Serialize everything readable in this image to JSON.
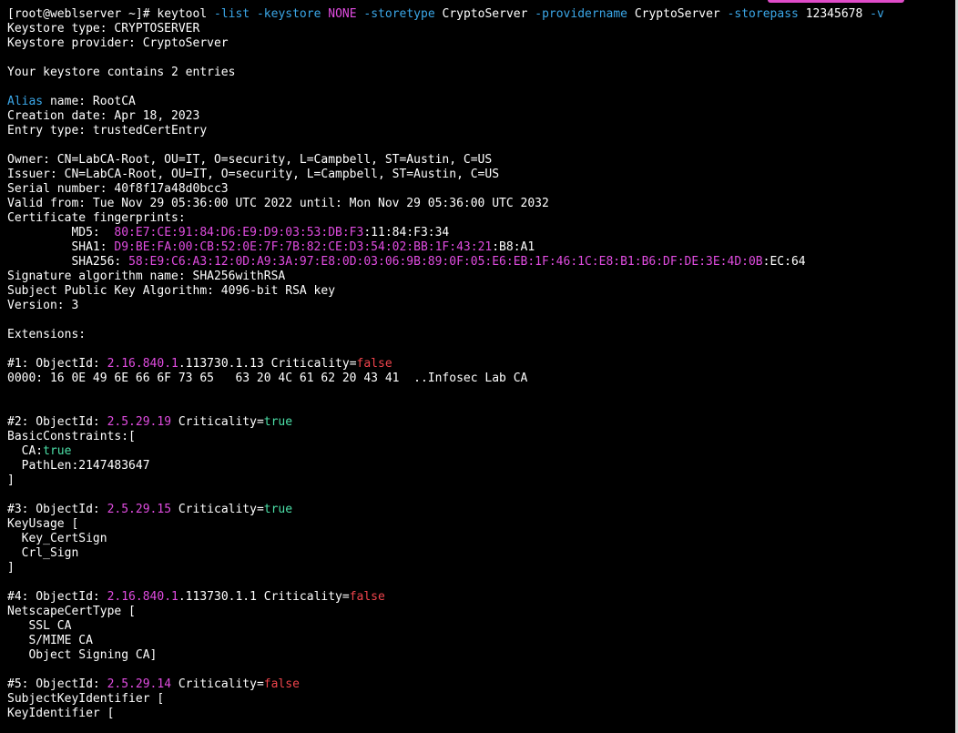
{
  "prompt": {
    "text": "[root@weblserver ~]# ",
    "cmd": "keytool",
    "opt_list": "-list",
    "opt_keystore": "-keystore",
    "keystore_value": "NONE",
    "opt_storetype": "-storetype",
    "storetype_value": "CryptoServer",
    "opt_providername": "-providername",
    "providername_value": "CryptoServer",
    "opt_storepass": "-storepass",
    "storepass_value": "12345678",
    "opt_v": "-v"
  },
  "keystore": {
    "type_line": "Keystore type: CRYPTOSERVER",
    "provider_line": "Keystore provider: CryptoServer",
    "entries_line": "Your keystore contains 2 entries"
  },
  "entry": {
    "alias_label": "Alias",
    "alias_rest": " name: RootCA",
    "creation": "Creation date: Apr 18, 2023",
    "entry_type": "Entry type: trustedCertEntry",
    "owner": "Owner: CN=LabCA-Root, OU=IT, O=security, L=Campbell, ST=Austin, C=US",
    "issuer": "Issuer: CN=LabCA-Root, OU=IT, O=security, L=Campbell, ST=Austin, C=US",
    "serial": "Serial number: 40f8f17a48d0bcc3",
    "valid": "Valid from: Tue Nov 29 05:36:00 UTC 2022 until: Mon Nov 29 05:36:00 UTC 2032",
    "fp_header": "Certificate fingerprints:",
    "md5_label": "         MD5:  ",
    "md5_hl": "80:E7:CE:91:84:D6:E9:D9:03:53:DB:F3",
    "md5_rest": ":11:84:F3:34",
    "sha1_label": "         SHA1: ",
    "sha1_hl": "D9:BE:FA:00:CB:52:0E:7F:7B:82:CE:D3:54:02:BB:1F:43:21",
    "sha1_rest": ":B8:A1",
    "sha256_label": "         SHA256: ",
    "sha256_hl": "58:E9:C6:A3:12:0D:A9:3A:97:E8:0D:03:06:9B:89:0F:05:E6:EB:1F:46:1C:E8:B1:B6:DF:DE:3E:4D:0B",
    "sha256_rest": ":EC:64",
    "sig_alg": "Signature algorithm name: SHA256withRSA",
    "pubkey": "Subject Public Key Algorithm: 4096-bit RSA key",
    "version": "Version: 3",
    "ext_header": "Extensions:"
  },
  "ext1": {
    "prefix": "#1: ObjectId: ",
    "oid_hl": "2.16.840.1",
    "oid_rest": ".113730.1.13 Criticality=",
    "crit": "false",
    "dump": "0000: 16 0E 49 6E 66 6F 73 65   63 20 4C 61 62 20 43 41  ..Infosec Lab CA"
  },
  "ext2": {
    "prefix": "#2: ObjectId: ",
    "oid_hl": "2.5.29.19",
    "oid_rest": " Criticality=",
    "crit": "true",
    "l1": "BasicConstraints:[",
    "ca_label": "  CA:",
    "ca_val": "true",
    "l3": "  PathLen:2147483647",
    "l4": "]"
  },
  "ext3": {
    "prefix": "#3: ObjectId: ",
    "oid_hl": "2.5.29.15",
    "oid_rest": " Criticality=",
    "crit": "true",
    "l1": "KeyUsage [",
    "l2": "  Key_CertSign",
    "l3": "  Crl_Sign",
    "l4": "]"
  },
  "ext4": {
    "prefix": "#4: ObjectId: ",
    "oid_hl": "2.16.840.1",
    "oid_rest": ".113730.1.1 Criticality=",
    "crit": "false",
    "l1": "NetscapeCertType [",
    "l2": "   SSL CA",
    "l3": "   S/MIME CA",
    "l4": "   Object Signing CA]"
  },
  "ext5": {
    "prefix": "#5: ObjectId: ",
    "oid_hl": "2.5.29.14",
    "oid_rest": " Criticality=",
    "crit": "false",
    "l1": "SubjectKeyIdentifier [",
    "l2": "KeyIdentifier ["
  },
  "colors": {
    "background": "#000000",
    "text": "#ffffff",
    "option": "#3ba7e8",
    "highlight": "#e04ce0",
    "false": "#f0444c",
    "true": "#4ce0a8"
  }
}
